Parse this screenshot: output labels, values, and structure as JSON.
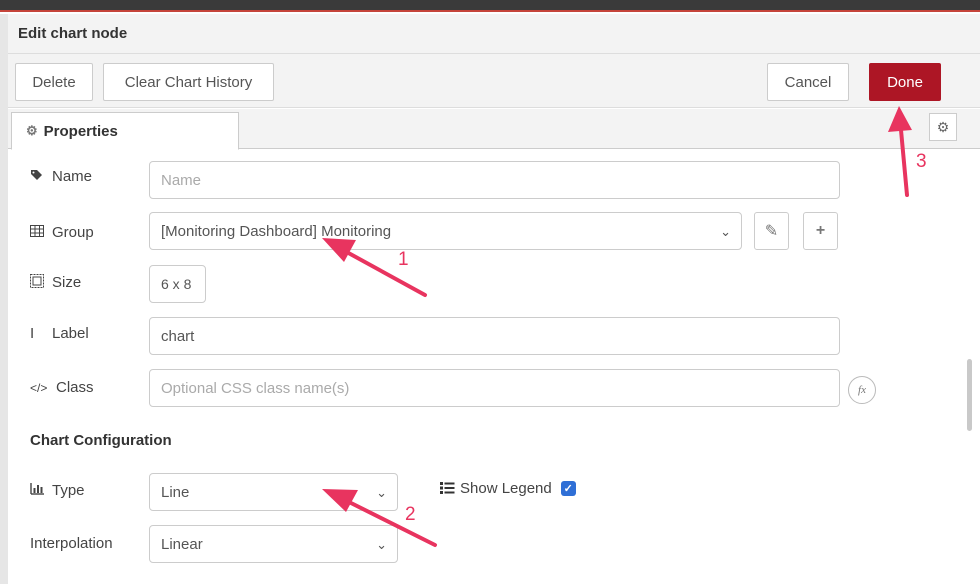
{
  "dialog": {
    "title": "Edit chart node"
  },
  "buttons": {
    "delete": "Delete",
    "clear_history": "Clear Chart History",
    "cancel": "Cancel",
    "done": "Done"
  },
  "tabs": [
    {
      "label": "Properties",
      "icon": "gear-icon",
      "active": true
    }
  ],
  "fields": {
    "name": {
      "label": "Name",
      "icon": "tag-icon",
      "value": "",
      "placeholder": "Name"
    },
    "group": {
      "label": "Group",
      "icon": "table-icon",
      "value": "[Monitoring Dashboard] Monitoring"
    },
    "size": {
      "label": "Size",
      "icon": "resize-icon",
      "value": "6 x 8"
    },
    "label": {
      "label": "Label",
      "icon": "text-cursor-icon",
      "value": "chart"
    },
    "class": {
      "label": "Class",
      "icon": "code-icon",
      "value": "",
      "placeholder": "Optional CSS class name(s)"
    }
  },
  "chart_config": {
    "section_title": "Chart Configuration",
    "type": {
      "label": "Type",
      "icon": "bar-chart-icon",
      "value": "Line"
    },
    "show_legend": {
      "label": "Show Legend",
      "icon": "list-icon",
      "checked": true
    },
    "interpolation": {
      "label": "Interpolation",
      "value": "Linear"
    }
  },
  "annotations": [
    "1",
    "2",
    "3"
  ],
  "colors": {
    "done_button": "#ad1625",
    "annotation": "#e8345f",
    "checkbox": "#2f6fd6"
  }
}
